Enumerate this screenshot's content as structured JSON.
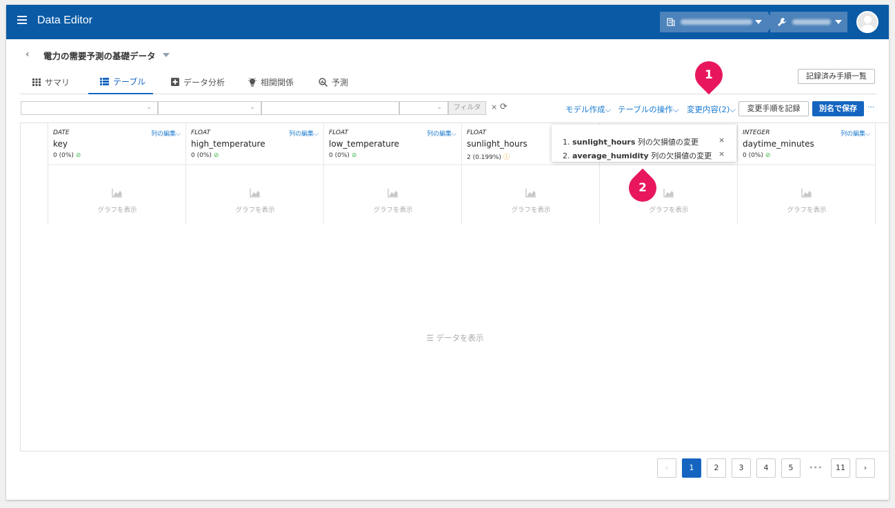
{
  "app": {
    "title": "Data Editor",
    "menu_icon": "hamburger-icon",
    "org_icon": "building-icon",
    "project_icon": "wrench-icon",
    "avatar_icon": "user-avatar-icon"
  },
  "dataset": {
    "title": "電力の需要予測の基礎データ",
    "back_icon": "chevron-left-icon"
  },
  "tabs": [
    {
      "label": "サマリ",
      "icon": "grid-icon",
      "active": false
    },
    {
      "label": "テーブル",
      "icon": "list-icon",
      "active": true
    },
    {
      "label": "データ分析",
      "icon": "plus-square-icon",
      "active": false
    },
    {
      "label": "相関関係",
      "icon": "bulb-icon",
      "active": false
    },
    {
      "label": "予測",
      "icon": "magnifier-chart-icon",
      "active": false
    }
  ],
  "toolbar": {
    "record_list_label": "記録済み手順一覧",
    "filter_label": "フィルタ",
    "clear_glyph": "×",
    "refresh_glyph": "⟳",
    "model_menu": "モデル作成",
    "table_ops_menu": "テーブルの操作",
    "changes_menu": "変更内容(2)",
    "menu_chevron": "⌵",
    "record_steps_label": "変更手順を記録",
    "save_as_label": "別名で保存",
    "more_glyph": "···"
  },
  "columns": [
    {
      "type": "DATE",
      "name": "key",
      "missing": "0 (0%)",
      "status": "ok",
      "edit_label": "列の編集",
      "graph_label": "グラフを表示"
    },
    {
      "type": "FLOAT",
      "name": "high_temperature",
      "missing": "0 (0%)",
      "status": "ok",
      "edit_label": "列の編集",
      "graph_label": "グラフを表示"
    },
    {
      "type": "FLOAT",
      "name": "low_temperature",
      "missing": "0 (0%)",
      "status": "ok",
      "edit_label": "列の編集",
      "graph_label": "グラフを表示"
    },
    {
      "type": "FLOAT",
      "name": "sunlight_hours",
      "missing": "2 (0.199%)",
      "status": "warn",
      "edit_label": "",
      "graph_label": "グラフを表示"
    },
    {
      "type": "",
      "name": "",
      "missing": "",
      "status": "",
      "edit_label": "",
      "graph_label": "グラフを表示"
    },
    {
      "type": "INTEGER",
      "name": "daytime_minutes",
      "missing": "0 (0%)",
      "status": "ok",
      "edit_label": "列の編集",
      "graph_label": "グラフを表示"
    }
  ],
  "status_glyphs": {
    "ok": "⊘",
    "warn": "ⓘ"
  },
  "show_data_label": "データを表示",
  "show_data_icon": "☰",
  "changes_popover": {
    "items": [
      {
        "num": "1.",
        "column": "sunlight_hours",
        "text": "列の欠損値の変更"
      },
      {
        "num": "2.",
        "column": "average_humidity",
        "text": "列の欠損値の変更"
      }
    ],
    "remove_glyph": "×"
  },
  "markers": [
    {
      "label": "1"
    },
    {
      "label": "2"
    }
  ],
  "pagination": {
    "prev": "‹",
    "pages": [
      "1",
      "2",
      "3",
      "4",
      "5"
    ],
    "ellipsis": "•••",
    "last": "11",
    "next": "›",
    "current": "1"
  },
  "colors": {
    "header_bg": "#0a5aa6",
    "accent": "#1565c0",
    "link": "#1a7bd0",
    "marker": "#e8175d",
    "ok": "#3bb54a",
    "warn": "#f0a31b"
  }
}
